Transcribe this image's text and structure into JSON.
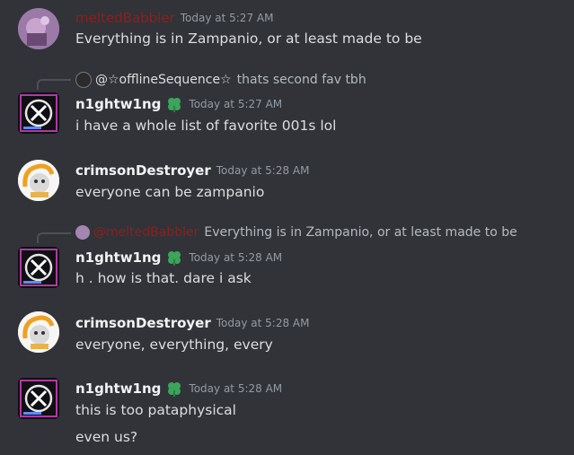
{
  "messages": [
    {
      "author": "meltedBabbler",
      "author_color": "#8b2020",
      "time": "Today at 5:27 AM",
      "text": "Everything is in Zampanio, or at least made to be"
    },
    {
      "reply_to_author": "@☆offlineSequence☆",
      "reply_to_text": "thats second fav tbh",
      "author": "n1ghtw1ng",
      "time": "Today at 5:27 AM",
      "text": "i have a whole list of favorite 001s lol"
    },
    {
      "author": "crimsonDestroyer",
      "time": "Today at 5:28 AM",
      "text": "everyone can be zampanio"
    },
    {
      "reply_to_author": "@meltedBabbler",
      "reply_to_text": "Everything is in Zampanio, or at least made to be",
      "author": "n1ghtw1ng",
      "time": "Today at 5:28 AM",
      "text": "h . how is that. dare i ask"
    },
    {
      "author": "crimsonDestroyer",
      "time": "Today at 5:28 AM",
      "text": "everyone, everything, every"
    },
    {
      "author": "n1ghtw1ng",
      "time": "Today at 5:28 AM",
      "text": "this is too pataphysical",
      "followup": "even us?"
    }
  ],
  "icons": {
    "badge": "clover-badge-icon"
  },
  "colors": {
    "background": "#313338",
    "badge": "#3ba55c",
    "muted_name": "#8b2020"
  }
}
